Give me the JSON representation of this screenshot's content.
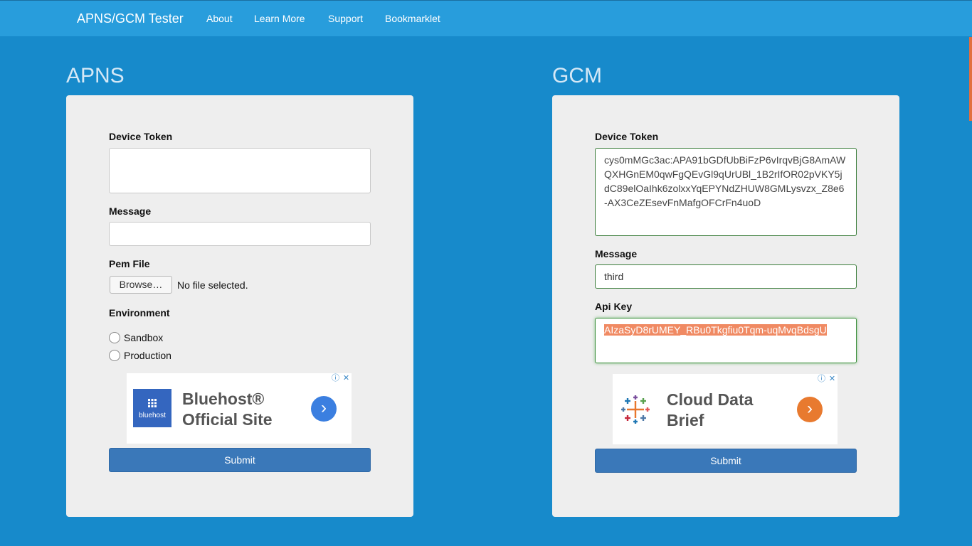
{
  "navbar": {
    "brand": "APNS/GCM Tester",
    "links": [
      "About",
      "Learn More",
      "Support",
      "Bookmarklet"
    ]
  },
  "apns": {
    "title": "APNS",
    "device_token_label": "Device Token",
    "device_token_value": "",
    "message_label": "Message",
    "message_value": "",
    "pem_file_label": "Pem File",
    "browse_label": "Browse…",
    "file_status": "No file selected.",
    "environment_label": "Environment",
    "environment_options": [
      "Sandbox",
      "Production"
    ],
    "ad": {
      "logo_text": "bluehost",
      "title": "Bluehost® Official Site",
      "arrow": "›",
      "arrow_color": "#3b7fe0"
    },
    "submit_label": "Submit"
  },
  "gcm": {
    "title": "GCM",
    "device_token_label": "Device Token",
    "device_token_value": "cys0mMGc3ac:APA91bGDfUbBiFzP6vIrqvBjG8AmAWQXHGnEM0qwFgQEvGl9qUrUBl_1B2rIfOR02pVKY5jdC89elOaIhk6zolxxYqEPYNdZHUW8GMLysvzx_Z8e6-AX3CeZEsevFnMafgOFCrFn4uoD",
    "message_label": "Message",
    "message_value": "third",
    "api_key_label": "Api Key",
    "api_key_value": "AIzaSyD8rUMEY_RBu0Tkgfiu0Tqm-uqMvqBdsgU",
    "ad": {
      "title": "Cloud Data Brief",
      "arrow": "›",
      "arrow_color": "#e87a2f"
    },
    "submit_label": "Submit"
  },
  "colors": {
    "background": "#178acb",
    "navbar": "#289ddc",
    "panel": "#eeeeee",
    "submit": "#3a78b9",
    "highlight": "#f08a63"
  },
  "icons": {
    "ad_info": "info-icon",
    "ad_close": "close-icon"
  }
}
